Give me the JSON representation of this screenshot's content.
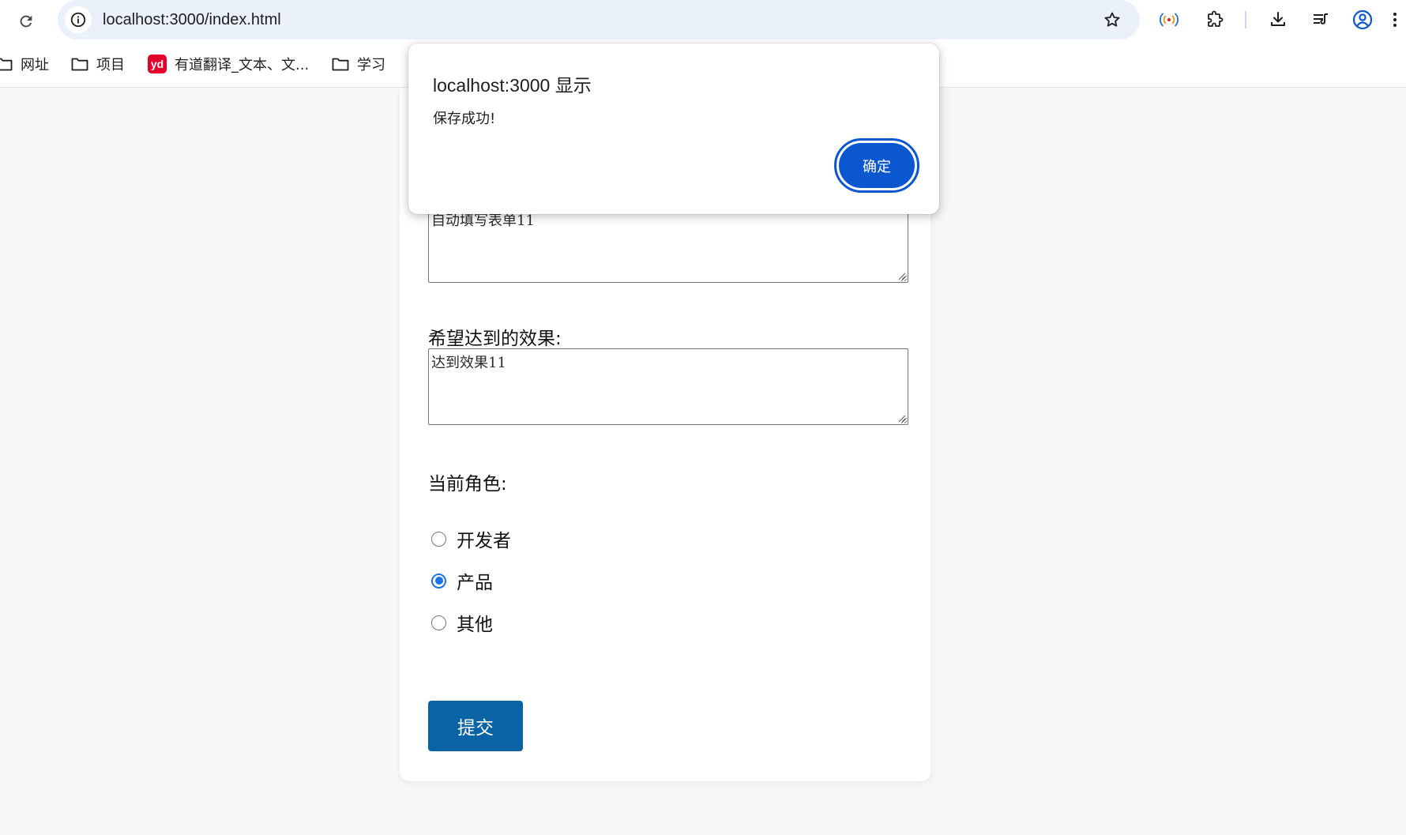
{
  "browser": {
    "url": "localhost:3000/index.html",
    "bookmarks": [
      {
        "label": "网址",
        "icon": "folder-icon"
      },
      {
        "label": "项目",
        "icon": "folder-icon"
      },
      {
        "label": "有道翻译_文本、文...",
        "icon": "youdao-logo",
        "logo_text": "yd"
      },
      {
        "label": "学习",
        "icon": "folder-icon"
      }
    ],
    "accent_color": "#0b57d0"
  },
  "form": {
    "problem_value": "自动填写表单11",
    "effect_label": "希望达到的效果:",
    "effect_value": "达到效果11",
    "role_label": "当前角色:",
    "roles": [
      {
        "label": "开发者",
        "checked": false
      },
      {
        "label": "产品",
        "checked": true
      },
      {
        "label": "其他",
        "checked": false
      }
    ],
    "submit_label": "提交",
    "submit_color": "#0a63a5"
  },
  "alert": {
    "title_host": "localhost:3000",
    "title_suffix": "显示",
    "message": "保存成功!",
    "ok_label": "确定"
  }
}
